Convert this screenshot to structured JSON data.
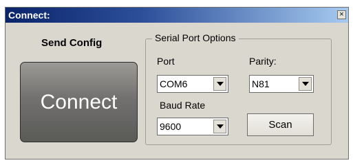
{
  "window": {
    "title": "Connect:",
    "close_label": "×"
  },
  "left": {
    "send_config_label": "Send Config",
    "connect_label": "Connect"
  },
  "serial_options": {
    "group_label": "Serial Port Options",
    "port_label": "Port",
    "port_value": "COM6",
    "parity_label": "Parity:",
    "parity_value": "N81",
    "baud_label": "Baud Rate",
    "baud_value": "9600",
    "scan_label": "Scan"
  }
}
